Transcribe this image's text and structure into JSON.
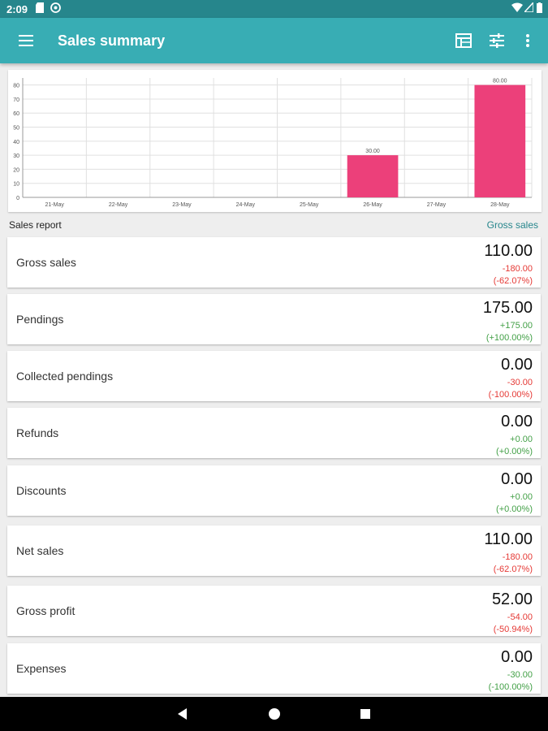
{
  "status": {
    "time": "2:09"
  },
  "app_bar": {
    "title": "Sales summary"
  },
  "icons": {
    "menu": "menu-icon",
    "table": "table-view-icon",
    "filter": "tune-icon",
    "more": "more-vert-icon"
  },
  "colors": {
    "primary": "#38adb4",
    "status_bar": "#26868c",
    "bar": "#ec407a",
    "negative": "#e53935",
    "positive": "#43a047"
  },
  "chart_data": {
    "type": "bar",
    "categories": [
      "21-May",
      "22-May",
      "23-May",
      "24-May",
      "25-May",
      "26-May",
      "27-May",
      "28-May"
    ],
    "values": [
      0,
      0,
      0,
      0,
      0,
      30,
      0,
      80
    ],
    "data_labels": [
      "",
      "",
      "",
      "",
      "",
      "30.00",
      "",
      "80.00"
    ],
    "yticks": [
      "0",
      "10",
      "20",
      "30",
      "40",
      "50",
      "60",
      "70",
      "80"
    ],
    "ylim": [
      0,
      85
    ],
    "grid": true,
    "title": "",
    "xlabel": "",
    "ylabel": ""
  },
  "section": {
    "title": "Sales report",
    "metric_selector": "Gross sales"
  },
  "rows": [
    {
      "label": "Gross sales",
      "value": "110.00",
      "delta": "-180.00",
      "pct": "(-62.07%)",
      "trend": "neg"
    },
    {
      "label": "Pendings",
      "value": "175.00",
      "delta": "+175.00",
      "pct": "(+100.00%)",
      "trend": "pos"
    },
    {
      "label": "Collected pendings",
      "value": "0.00",
      "delta": "-30.00",
      "pct": "(-100.00%)",
      "trend": "neg"
    },
    {
      "label": "Refunds",
      "value": "0.00",
      "delta": "+0.00",
      "pct": "(+0.00%)",
      "trend": "pos"
    },
    {
      "label": "Discounts",
      "value": "0.00",
      "delta": "+0.00",
      "pct": "(+0.00%)",
      "trend": "pos"
    },
    {
      "label": "Net sales",
      "value": "110.00",
      "delta": "-180.00",
      "pct": "(-62.07%)",
      "trend": "neg"
    },
    {
      "label": "Gross profit",
      "value": "52.00",
      "delta": "-54.00",
      "pct": "(-50.94%)",
      "trend": "neg"
    },
    {
      "label": "Expenses",
      "value": "0.00",
      "delta": "-30.00",
      "pct": "(-100.00%)",
      "trend": "pos"
    }
  ]
}
